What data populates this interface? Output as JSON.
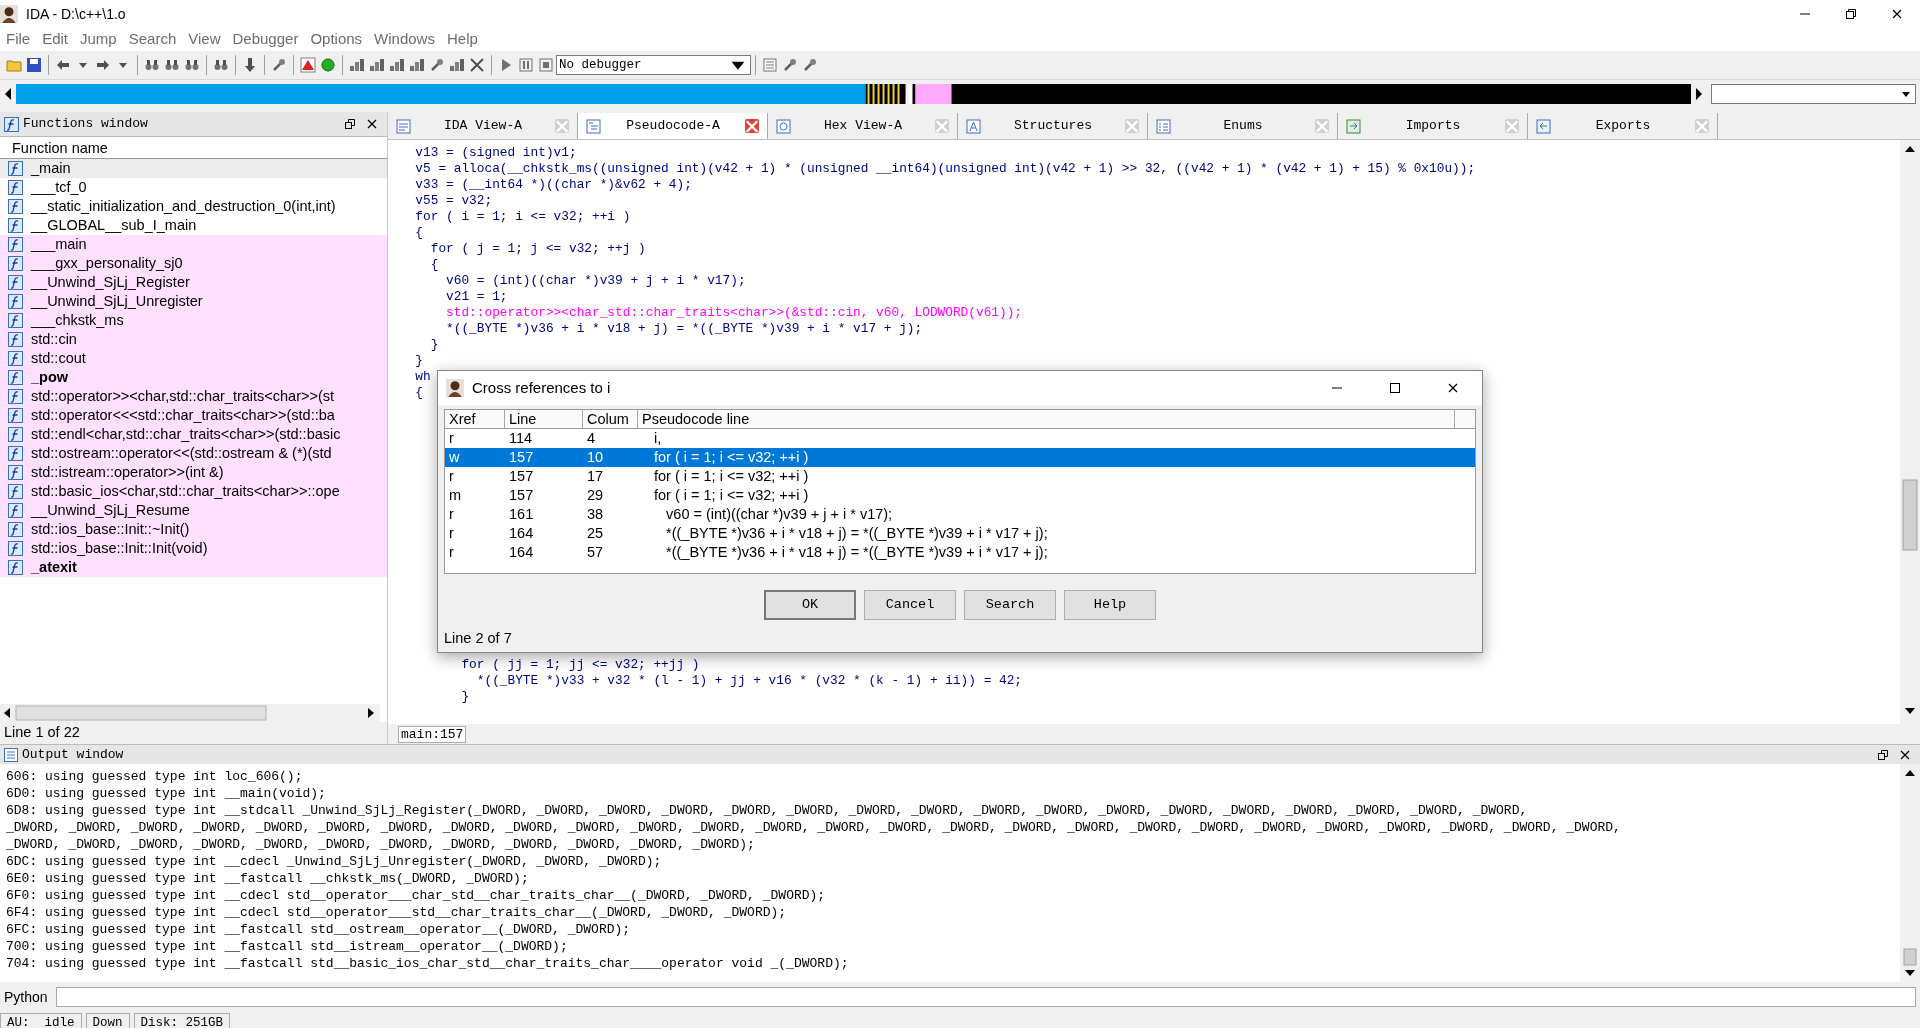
{
  "window": {
    "title": "IDA - D:\\c++\\1.o"
  },
  "menu": [
    "File",
    "Edit",
    "Jump",
    "Search",
    "View",
    "Debugger",
    "Options",
    "Windows",
    "Help"
  ],
  "toolbar": {
    "debugger_select": "No debugger"
  },
  "functions_window": {
    "title": "Functions window",
    "column": "Function name",
    "status": "Line 1 of 22",
    "items": [
      {
        "name": "_main",
        "selected": true,
        "library": false,
        "emphasized": false
      },
      {
        "name": "___tcf_0",
        "selected": false,
        "library": false,
        "emphasized": false
      },
      {
        "name": "__static_initialization_and_destruction_0(int,int)",
        "selected": false,
        "library": false,
        "emphasized": false
      },
      {
        "name": "__GLOBAL__sub_I_main",
        "selected": false,
        "library": false,
        "emphasized": false
      },
      {
        "name": "___main",
        "selected": false,
        "library": true,
        "emphasized": false
      },
      {
        "name": "___gxx_personality_sj0",
        "selected": false,
        "library": true,
        "emphasized": false
      },
      {
        "name": "__Unwind_SjLj_Register",
        "selected": false,
        "library": true,
        "emphasized": false
      },
      {
        "name": "__Unwind_SjLj_Unregister",
        "selected": false,
        "library": true,
        "emphasized": false
      },
      {
        "name": "___chkstk_ms",
        "selected": false,
        "library": true,
        "emphasized": false
      },
      {
        "name": "std::cin",
        "selected": false,
        "library": true,
        "emphasized": false
      },
      {
        "name": "std::cout",
        "selected": false,
        "library": true,
        "emphasized": false
      },
      {
        "name": "_pow",
        "selected": false,
        "library": true,
        "emphasized": true
      },
      {
        "name": "std::operator>><char,std::char_traits<char>>(st",
        "selected": false,
        "library": true,
        "emphasized": false
      },
      {
        "name": "std::operator<<<std::char_traits<char>>(std::ba",
        "selected": false,
        "library": true,
        "emphasized": false
      },
      {
        "name": "std::endl<char,std::char_traits<char>>(std::basic",
        "selected": false,
        "library": true,
        "emphasized": false
      },
      {
        "name": "std::ostream::operator<<(std::ostream & (*)(std",
        "selected": false,
        "library": true,
        "emphasized": false
      },
      {
        "name": "std::istream::operator>>(int &)",
        "selected": false,
        "library": true,
        "emphasized": false
      },
      {
        "name": "std::basic_ios<char,std::char_traits<char>>::ope",
        "selected": false,
        "library": true,
        "emphasized": false
      },
      {
        "name": "__Unwind_SjLj_Resume",
        "selected": false,
        "library": true,
        "emphasized": false
      },
      {
        "name": "std::ios_base::Init::~Init()",
        "selected": false,
        "library": true,
        "emphasized": false
      },
      {
        "name": "std::ios_base::Init::Init(void)",
        "selected": false,
        "library": true,
        "emphasized": false
      },
      {
        "name": "_atexit",
        "selected": false,
        "library": true,
        "emphasized": true
      }
    ]
  },
  "tabs": [
    {
      "label": "IDA View-A",
      "selected": false
    },
    {
      "label": "Pseudocode-A",
      "selected": true
    },
    {
      "label": "Hex View-A",
      "selected": false
    },
    {
      "label": "Structures",
      "selected": false
    },
    {
      "label": "Enums",
      "selected": false
    },
    {
      "label": "Imports",
      "selected": false
    },
    {
      "label": "Exports",
      "selected": false
    }
  ],
  "pseudocode": {
    "location": "main:157",
    "lines_top": [
      {
        "text": "  v13 = (signed int)v1;",
        "kind": "code"
      },
      {
        "text": "  v5 = alloca(__chkstk_ms((unsigned int)(v42 + 1) * (unsigned __int64)(unsigned int)(v42 + 1) >> 32, ((v42 + 1) * (v42 + 1) + 15) % 0x10u));",
        "kind": "code"
      },
      {
        "text": "  v33 = (__int64 *)((char *)&v62 + 4);",
        "kind": "code"
      },
      {
        "text": "  v55 = v32;",
        "kind": "code"
      },
      {
        "text": "  for ( i = 1; i <= v32; ++i )",
        "kind": "code"
      },
      {
        "text": "  {",
        "kind": "code"
      },
      {
        "text": "    for ( j = 1; j <= v32; ++j )",
        "kind": "code"
      },
      {
        "text": "    {",
        "kind": "code"
      },
      {
        "text": "      v60 = (int)((char *)v39 + j + i * v17);",
        "kind": "code"
      },
      {
        "text": "      v21 = 1;",
        "kind": "code"
      },
      {
        "text": "      std::operator>><char_std::char_traits<char>>(&std::cin, v60, LODWORD(v61));",
        "kind": "call"
      },
      {
        "text": "      *((_BYTE *)v36 + i * v18 + j) = *((_BYTE *)v39 + i * v17 + j);",
        "kind": "code"
      },
      {
        "text": "    }",
        "kind": "code"
      },
      {
        "text": "  }",
        "kind": "code"
      },
      {
        "text": "  wh",
        "kind": "code"
      },
      {
        "text": "  {",
        "kind": "code"
      }
    ],
    "lines_bottom": [
      {
        "text": "        for ( jj = 1; jj <= v32; ++jj )",
        "kind": "code"
      },
      {
        "text": "          *((_BYTE *)v33 + v32 * (l - 1) + jj + v16 * (v32 * (k - 1) + ii)) = 42;",
        "kind": "code"
      },
      {
        "text": "        }",
        "kind": "code"
      }
    ]
  },
  "xref_dialog": {
    "title": "Cross references to i",
    "columns": [
      "Xref",
      "Line",
      "Colum",
      "Pseudocode line"
    ],
    "rows": [
      {
        "xref": "r",
        "line": "114",
        "column": "4",
        "code": "i,",
        "selected": false
      },
      {
        "xref": "w",
        "line": "157",
        "column": "10",
        "code": "for ( i = 1; i <= v32; ++i )",
        "selected": true
      },
      {
        "xref": "r",
        "line": "157",
        "column": "17",
        "code": "for ( i = 1; i <= v32; ++i )",
        "selected": false
      },
      {
        "xref": "m",
        "line": "157",
        "column": "29",
        "code": "for ( i = 1; i <= v32; ++i )",
        "selected": false
      },
      {
        "xref": "r",
        "line": "161",
        "column": "38",
        "code": "   v60 = (int)((char *)v39 + j + i * v17);",
        "selected": false
      },
      {
        "xref": "r",
        "line": "164",
        "column": "25",
        "code": "   *((_BYTE *)v36 + i * v18 + j) = *((_BYTE *)v39 + i * v17 + j);",
        "selected": false
      },
      {
        "xref": "r",
        "line": "164",
        "column": "57",
        "code": "   *((_BYTE *)v36 + i * v18 + j) = *((_BYTE *)v39 + i * v17 + j);",
        "selected": false
      }
    ],
    "buttons": [
      "OK",
      "Cancel",
      "Search",
      "Help"
    ],
    "status": "Line 2 of 7"
  },
  "output_window": {
    "title": "Output window",
    "lines": [
      "606: using guessed type int loc_606();",
      "6D0: using guessed type int __main(void);",
      "6D8: using guessed type int __stdcall _Unwind_SjLj_Register(_DWORD, _DWORD, _DWORD, _DWORD, _DWORD, _DWORD, _DWORD, _DWORD, _DWORD, _DWORD, _DWORD, _DWORD, _DWORD, _DWORD, _DWORD, _DWORD, _DWORD,",
      "_DWORD, _DWORD, _DWORD, _DWORD, _DWORD, _DWORD, _DWORD, _DWORD, _DWORD, _DWORD, _DWORD, _DWORD, _DWORD, _DWORD, _DWORD, _DWORD, _DWORD, _DWORD, _DWORD, _DWORD, _DWORD, _DWORD, _DWORD, _DWORD, _DWORD, _DWORD,",
      "_DWORD, _DWORD, _DWORD, _DWORD, _DWORD, _DWORD, _DWORD, _DWORD, _DWORD, _DWORD, _DWORD, _DWORD);",
      "6DC: using guessed type int __cdecl _Unwind_SjLj_Unregister(_DWORD, _DWORD, _DWORD);",
      "6E0: using guessed type int __fastcall __chkstk_ms(_DWORD, _DWORD);",
      "6F0: using guessed type int __cdecl std__operator___char_std__char_traits_char__(_DWORD, _DWORD, _DWORD);",
      "6F4: using guessed type int __cdecl std__operator___std__char_traits_char__(_DWORD, _DWORD, _DWORD);",
      "6FC: using guessed type int __fastcall std__ostream__operator__(_DWORD, _DWORD);",
      "700: using guessed type int __fastcall std__istream__operator__(_DWORD);",
      "704: using guessed type int __fastcall std__basic_ios_char_std__char_traits_char____operator void _(_DWORD);"
    ]
  },
  "python": {
    "label": "Python"
  },
  "status_bar": [
    "AU:  idle",
    "Down",
    "Disk: 251GB"
  ]
}
